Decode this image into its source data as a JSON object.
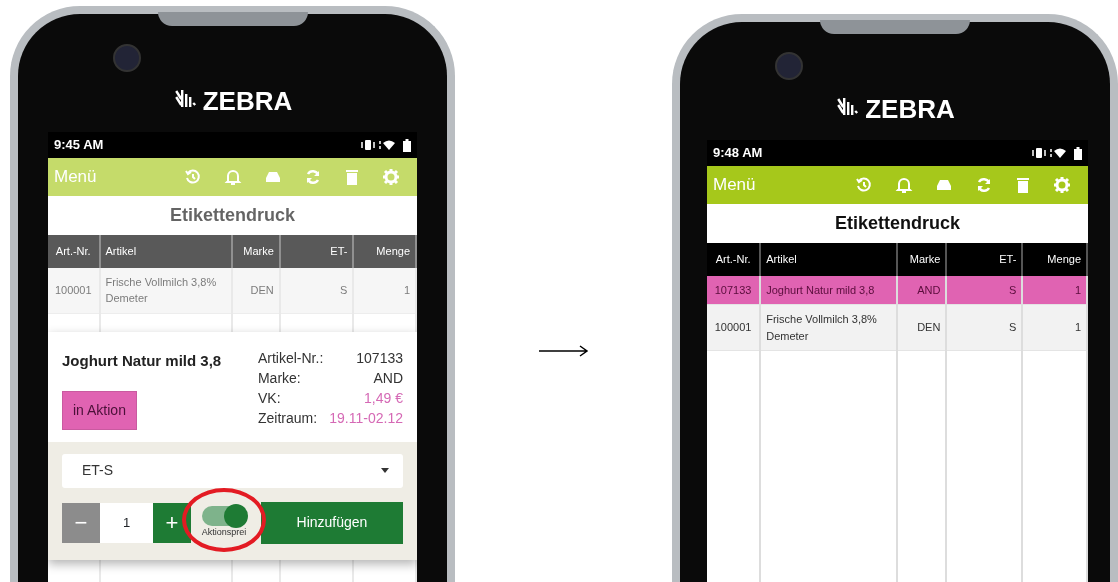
{
  "phones": [
    {
      "brand": "ZEBRA",
      "time": "9:45 AM",
      "menu_label": "Menü",
      "title": "Etikettendruck",
      "table": {
        "columns": [
          "Art.-Nr.",
          "Artikel",
          "Marke",
          "ET-",
          "Menge"
        ],
        "rows": [
          {
            "cells": [
              "100001",
              "Frische Vollmilch 3,8% Demeter",
              "DEN",
              "S",
              "1"
            ],
            "selected": false
          }
        ]
      },
      "dialog": {
        "product_name": "Joghurt Natur mild 3,8",
        "badge": "in Aktion",
        "details": [
          {
            "label": "Artikel-Nr.:",
            "value": "107133",
            "highlight": false
          },
          {
            "label": "Marke:",
            "value": "AND",
            "highlight": false
          },
          {
            "label": "VK:",
            "value": "1,49 €",
            "highlight": true
          },
          {
            "label": "Zeitraum:",
            "value": "19.11-02.12",
            "highlight": true
          }
        ],
        "label_type": "ET-S",
        "decrement_label": "−",
        "quantity": "1",
        "increment_label": "+",
        "toggle": {
          "label": "Aktionsprei",
          "on": true,
          "circled": true
        },
        "add_button": "Hinzufügen"
      }
    },
    {
      "brand": "ZEBRA",
      "time": "9:48 AM",
      "menu_label": "Menü",
      "title": "Etikettendruck",
      "table": {
        "columns": [
          "Art.-Nr.",
          "Artikel",
          "Marke",
          "ET-",
          "Menge"
        ],
        "rows": [
          {
            "cells": [
              "107133",
              "Joghurt Natur mild 3,8",
              "AND",
              "S",
              "1"
            ],
            "selected": true
          },
          {
            "cells": [
              "100001",
              "Frische Vollmilch 3,8% Demeter",
              "DEN",
              "S",
              "1"
            ],
            "selected": false
          }
        ]
      }
    }
  ]
}
